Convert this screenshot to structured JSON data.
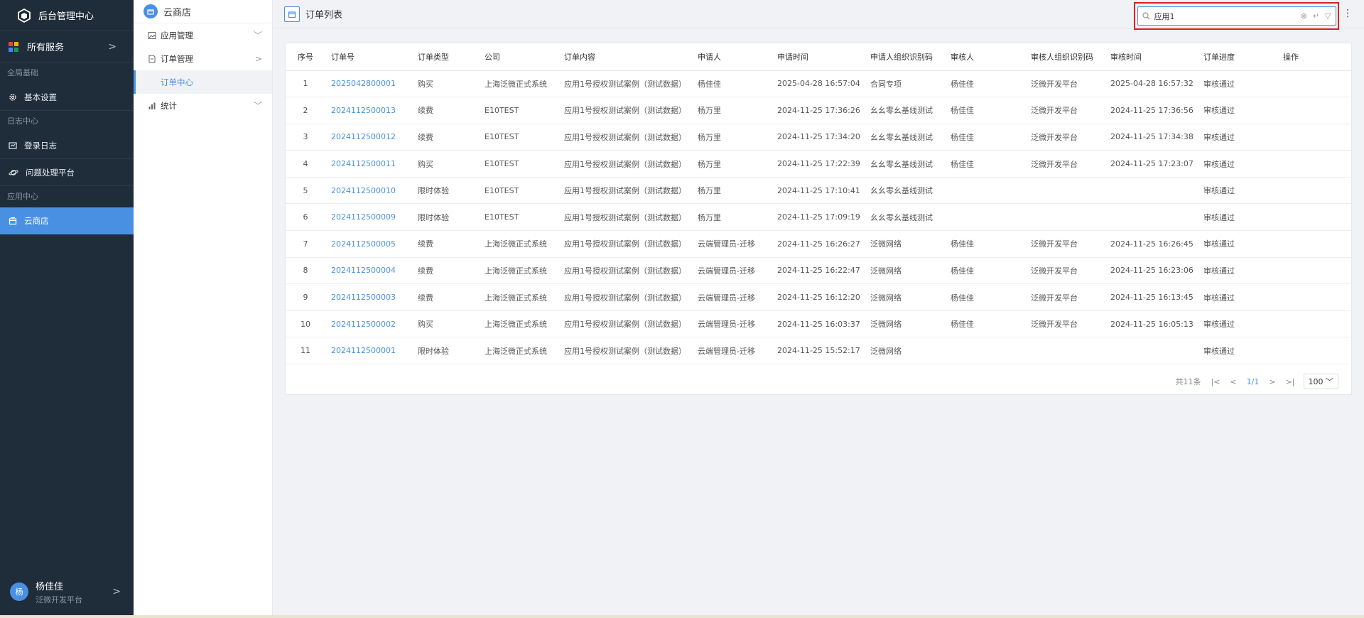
{
  "app": {
    "title": "后台管理中心"
  },
  "sidebar": {
    "all_services": "所有服务",
    "groups": [
      {
        "title": "全局基础",
        "items": [
          {
            "label": "基本设置",
            "icon": "gear-icon"
          }
        ]
      },
      {
        "title": "日志中心",
        "items": [
          {
            "label": "登录日志",
            "icon": "log-icon"
          },
          {
            "label": "问题处理平台",
            "icon": "planet-icon"
          }
        ]
      },
      {
        "title": "应用中心",
        "items": [
          {
            "label": "云商店",
            "icon": "store-icon",
            "active": true
          }
        ]
      }
    ],
    "user": {
      "avatar": "杨",
      "name": "杨佳佳",
      "org": "泛微开发平台"
    }
  },
  "subnav": {
    "title": "云商店",
    "menus": [
      {
        "label": "应用管理",
        "chev": "v"
      },
      {
        "label": "订单管理",
        "chev": ">"
      },
      {
        "label": "订单中心",
        "sub": true
      },
      {
        "label": "统计",
        "chev": "v"
      }
    ]
  },
  "header": {
    "page_title": "订单列表"
  },
  "search": {
    "value": "应用1",
    "clear": "⊗",
    "enter": "↵",
    "filter": "▽"
  },
  "table": {
    "columns": [
      "序号",
      "订单号",
      "订单类型",
      "公司",
      "订单内容",
      "申请人",
      "申请时间",
      "申请人组织识别码",
      "审核人",
      "审核人组织识别码",
      "审核时间",
      "订单进度",
      "操作"
    ],
    "rows": [
      [
        "1",
        "2025042800001",
        "购买",
        "上海泛微正式系统",
        "应用1号授权测试案例（测试数据）",
        "杨佳佳",
        "2025-04-28 16:57:04",
        "合同专项",
        "杨佳佳",
        "泛微开发平台",
        "2025-04-28 16:57:32",
        "审核通过",
        ""
      ],
      [
        "2",
        "2024112500013",
        "续费",
        "E10TEST",
        "应用1号授权测试案例（测试数据）",
        "杨万里",
        "2024-11-25 17:36:26",
        "幺幺零幺基线测试",
        "杨佳佳",
        "泛微开发平台",
        "2024-11-25 17:36:56",
        "审核通过",
        ""
      ],
      [
        "3",
        "2024112500012",
        "续费",
        "E10TEST",
        "应用1号授权测试案例（测试数据）",
        "杨万里",
        "2024-11-25 17:34:20",
        "幺幺零幺基线测试",
        "杨佳佳",
        "泛微开发平台",
        "2024-11-25 17:34:38",
        "审核通过",
        ""
      ],
      [
        "4",
        "2024112500011",
        "购买",
        "E10TEST",
        "应用1号授权测试案例（测试数据）",
        "杨万里",
        "2024-11-25 17:22:39",
        "幺幺零幺基线测试",
        "杨佳佳",
        "泛微开发平台",
        "2024-11-25 17:23:07",
        "审核通过",
        ""
      ],
      [
        "5",
        "2024112500010",
        "限时体验",
        "E10TEST",
        "应用1号授权测试案例（测试数据）",
        "杨万里",
        "2024-11-25 17:10:41",
        "幺幺零幺基线测试",
        "",
        "",
        "",
        "审核通过",
        ""
      ],
      [
        "6",
        "2024112500009",
        "限时体验",
        "E10TEST",
        "应用1号授权测试案例（测试数据）",
        "杨万里",
        "2024-11-25 17:09:19",
        "幺幺零幺基线测试",
        "",
        "",
        "",
        "审核通过",
        ""
      ],
      [
        "7",
        "2024112500005",
        "续费",
        "上海泛微正式系统",
        "应用1号授权测试案例（测试数据）",
        "云端管理员-迁移",
        "2024-11-25 16:26:27",
        "泛微网络",
        "杨佳佳",
        "泛微开发平台",
        "2024-11-25 16:26:45",
        "审核通过",
        ""
      ],
      [
        "8",
        "2024112500004",
        "续费",
        "上海泛微正式系统",
        "应用1号授权测试案例（测试数据）",
        "云端管理员-迁移",
        "2024-11-25 16:22:47",
        "泛微网络",
        "杨佳佳",
        "泛微开发平台",
        "2024-11-25 16:23:06",
        "审核通过",
        ""
      ],
      [
        "9",
        "2024112500003",
        "续费",
        "上海泛微正式系统",
        "应用1号授权测试案例（测试数据）",
        "云端管理员-迁移",
        "2024-11-25 16:12:20",
        "泛微网络",
        "杨佳佳",
        "泛微开发平台",
        "2024-11-25 16:13:45",
        "审核通过",
        ""
      ],
      [
        "10",
        "2024112500002",
        "购买",
        "上海泛微正式系统",
        "应用1号授权测试案例（测试数据）",
        "云端管理员-迁移",
        "2024-11-25 16:03:37",
        "泛微网络",
        "杨佳佳",
        "泛微开发平台",
        "2024-11-25 16:05:13",
        "审核通过",
        ""
      ],
      [
        "11",
        "2024112500001",
        "限时体验",
        "上海泛微正式系统",
        "应用1号授权测试案例（测试数据）",
        "云端管理员-迁移",
        "2024-11-25 15:52:17",
        "泛微网络",
        "",
        "",
        "",
        "审核通过",
        ""
      ]
    ]
  },
  "pager": {
    "total": "共11条",
    "first": "|<",
    "prev": "<",
    "current": "1/1",
    "next": ">",
    "last": ">|",
    "page_size": "100"
  },
  "colors": {
    "sidebar_bg": "#1f2c3a",
    "accent": "#4a90e2",
    "highlight": "#e02020"
  }
}
